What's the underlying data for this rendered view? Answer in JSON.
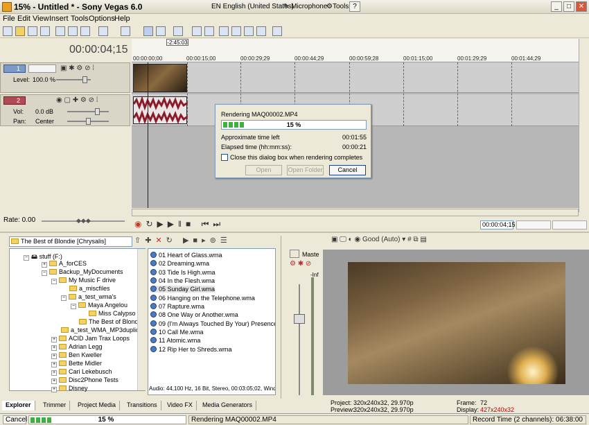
{
  "window": {
    "title": "15% - Untitled * - Sony Vegas 6.0",
    "language": "EN English (United States)",
    "microphone": "Microphone",
    "tools": "Tools",
    "help_icon": "?"
  },
  "menu": [
    "File",
    "Edit",
    "View",
    "Insert",
    "Tools",
    "Options",
    "Help"
  ],
  "timeline": {
    "timecode": "00:00:04;15",
    "marker": "-2:45:03",
    "ruler_ticks": [
      "00:00:00;00",
      "00:00:15;00",
      "00:00:29;29",
      "00:00:44;29",
      "00:00:59;28",
      "00:01:15;00",
      "00:01:29;29",
      "00:01:44;29"
    ]
  },
  "tracks": {
    "video": {
      "number": "1",
      "level_label": "Level:",
      "level_value": "100.0 %"
    },
    "audio": {
      "number": "2",
      "vol_label": "Vol:",
      "vol_value": "0.0 dB",
      "pan_label": "Pan:",
      "pan_value": "Center"
    }
  },
  "rate": "Rate: 0.00",
  "transport": {
    "position": "00:00:04;15"
  },
  "render_dialog": {
    "title": "Rendering MAQ00002.MP4",
    "percent": "15 %",
    "progress": 0.15,
    "approx_label": "Approximate time left",
    "approx_value": "00:01:55",
    "elapsed_label": "Elapsed time (hh:mm:ss):",
    "elapsed_value": "00:00:21",
    "checkbox_label": "Close this dialog box when rendering completes",
    "open": "Open",
    "open_folder": "Open Folder",
    "cancel": "Cancel"
  },
  "explorer": {
    "path": "The Best of Blondie [Chrysalis]",
    "tree": [
      "stuff (F:)",
      "A_forCES",
      "Backup_MyDocuments",
      "My Music F drive",
      "a_miscfiles",
      "a_test_wma's",
      "Maya Angelou",
      "Miss Calypso",
      "The Best of Blondie [Ch",
      "a_test_WMA_MP3duplicate",
      "ACID Jam Trax Loops",
      "Adrian Legg",
      "Ben Kweller",
      "Bette Midler",
      "Cari Lekebusch",
      "Disc2Phone Tests",
      "Disney"
    ],
    "files": [
      "01 Heart of Glass.wma",
      "02 Dreaming.wma",
      "03 Tide Is High.wma",
      "04 In the Flesh.wma",
      "05 Sunday Girl.wma",
      "06 Hanging on the Telephone.wma",
      "07 Rapture.wma",
      "08 One Way or Another.wma",
      "09 (I'm Always Touched By Your) Presence.wma",
      "10 Call Me.wma",
      "11 Atomic.wma",
      "12 Rip Her to Shreds.wma"
    ],
    "file_info": "Audio: 44,100 Hz, 16 Bit, Stereo, 00:03:05;02, Wind"
  },
  "tabs": [
    "Explorer",
    "Trimmer",
    "Project Media",
    "Transitions",
    "Video FX",
    "Media Generators"
  ],
  "mixer": {
    "label": "Maste",
    "db": "-Inf"
  },
  "preview": {
    "quality": "Good (Auto)",
    "project_label": "Project:",
    "project_value": "320x240x32, 29.970p",
    "preview_label": "Preview:",
    "preview_value": "320x240x32, 29.970p",
    "frame_label": "Frame:",
    "frame_value": "72",
    "display_label": "Display:",
    "display_value": "427x240x32"
  },
  "statusbar": {
    "cancel": "Cancel",
    "percent": "15 %",
    "message": "Rendering MAQ00002.MP4",
    "record_time": "Record Time (2 channels): 06:38:00"
  },
  "colors": {
    "accent": "#316ac5",
    "progress": "#3db03d",
    "waveform": "#8b1a2a"
  }
}
